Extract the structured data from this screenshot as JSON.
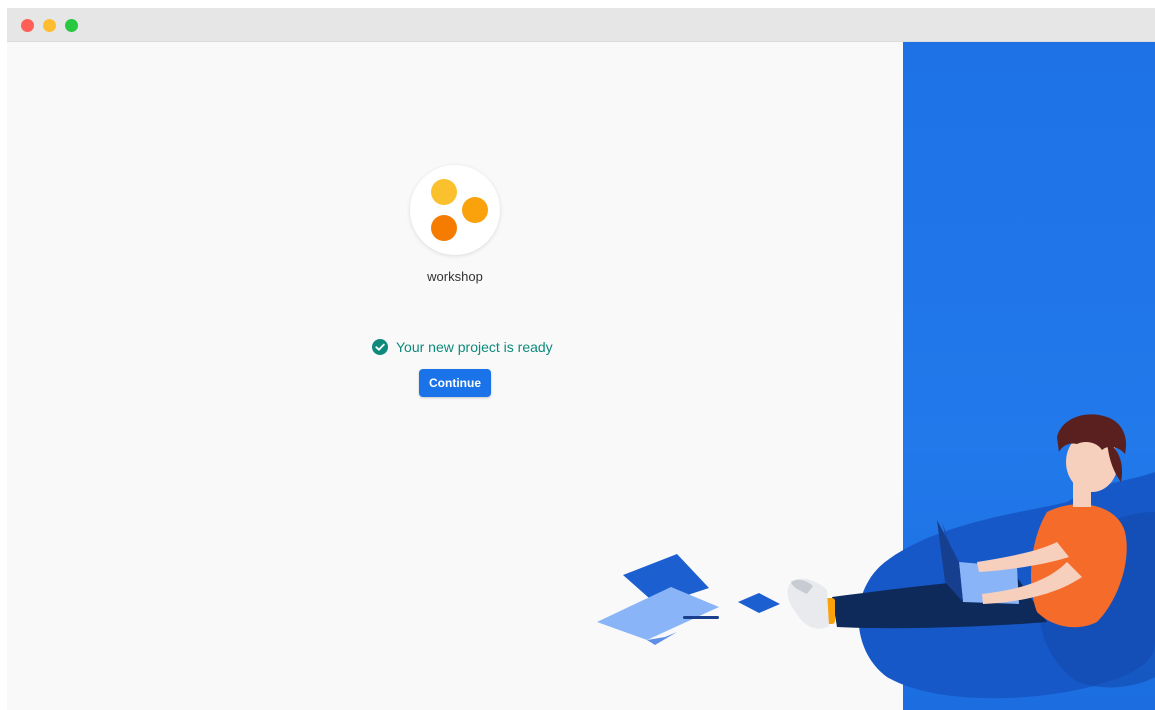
{
  "window": {
    "controls": {
      "close_color": "#ff5f57",
      "minimize_color": "#febc2e",
      "maximize_color": "#28c840"
    }
  },
  "project": {
    "name": "workshop",
    "logo_colors": [
      "#fbc02d",
      "#f9a20b",
      "#f57c00"
    ]
  },
  "status": {
    "icon": "check-circle-icon",
    "text": "Your new project is ready",
    "color": "#0e8a7d"
  },
  "actions": {
    "continue_label": "Continue",
    "accent": "#1a73e8"
  },
  "illustration": {
    "description_icon": "person-with-laptop-illustration",
    "panel_color": "#1e72e6"
  }
}
